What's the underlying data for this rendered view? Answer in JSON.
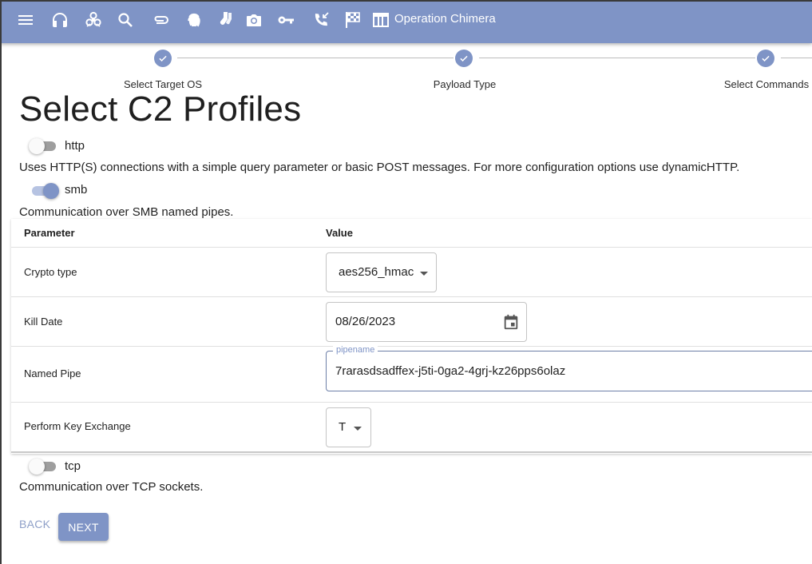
{
  "appbar": {
    "title": "Operation Chimera",
    "icons": [
      "menu-icon",
      "headset-icon",
      "biohazard-icon",
      "search-icon",
      "paperclip-icon",
      "fingerprint-icon",
      "socks-icon",
      "camera-icon",
      "key-icon",
      "phone-callback-icon",
      "checkered-flag-icon",
      "table-icon"
    ]
  },
  "stepper": {
    "steps": [
      {
        "label": "Select Target OS",
        "status": "completed"
      },
      {
        "label": "Payload Type",
        "status": "completed"
      },
      {
        "label": "Select Commands",
        "status": "completed"
      }
    ]
  },
  "page": {
    "title": "Select C2 Profiles"
  },
  "profiles": [
    {
      "name": "http",
      "enabled": false,
      "description": "Uses HTTP(S) connections with a simple query parameter or basic POST messages. For more configuration options use dynamicHTTP."
    },
    {
      "name": "smb",
      "enabled": true,
      "description": "Communication over SMB named pipes."
    },
    {
      "name": "tcp",
      "enabled": false,
      "description": "Communication over TCP sockets."
    }
  ],
  "params_table": {
    "headers": {
      "parameter": "Parameter",
      "value": "Value"
    },
    "rows": [
      {
        "name": "Crypto type",
        "value": "aes256_hmac",
        "kind": "select"
      },
      {
        "name": "Kill Date",
        "value": "08/26/2023",
        "kind": "date"
      },
      {
        "name": "Named Pipe",
        "value": "7rarasdsadffex-j5ti-0ga2-4grj-kz26pps6olaz",
        "field_label": "pipename",
        "kind": "text"
      },
      {
        "name": "Perform Key Exchange",
        "value": "T",
        "kind": "select"
      }
    ]
  },
  "actions": {
    "back": "BACK",
    "next": "NEXT"
  },
  "colors": {
    "primary": "#7f94c6",
    "primary_light": "#b6c3e2"
  }
}
